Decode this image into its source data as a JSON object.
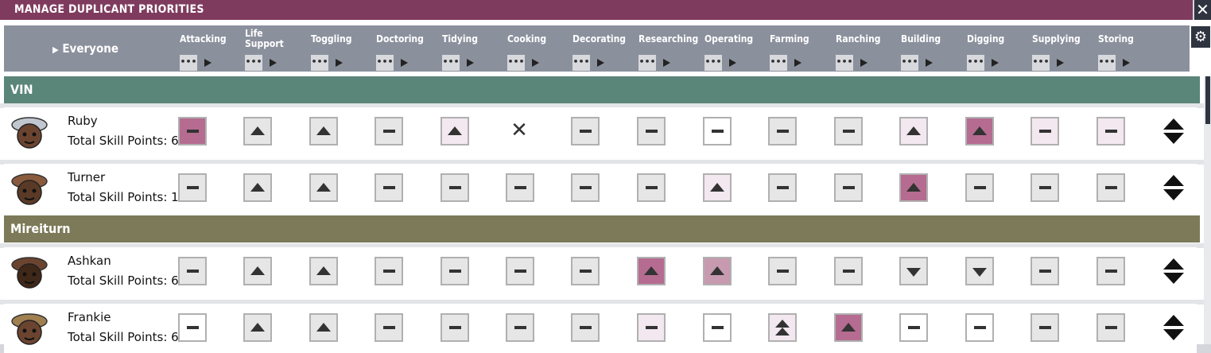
{
  "window": {
    "title": "MANAGE DUPLICANT PRIORITIES",
    "close_icon": "close-icon",
    "settings_icon": "gear-icon"
  },
  "everyone_label": "Everyone",
  "columns": [
    {
      "label": "Attacking"
    },
    {
      "label": "Life Support"
    },
    {
      "label": "Toggling"
    },
    {
      "label": "Doctoring"
    },
    {
      "label": "Tidying"
    },
    {
      "label": "Cooking"
    },
    {
      "label": "Decorating"
    },
    {
      "label": "Researching"
    },
    {
      "label": "Operating"
    },
    {
      "label": "Farming"
    },
    {
      "label": "Ranching"
    },
    {
      "label": "Building"
    },
    {
      "label": "Digging"
    },
    {
      "label": "Supplying"
    },
    {
      "label": "Storing"
    }
  ],
  "dots_label": "•••",
  "groups": [
    {
      "name": "VIN",
      "color": "#5a8579",
      "duplicants": [
        {
          "name": "Ruby",
          "skill_points": "Total Skill Points: 6",
          "cells": [
            "5d",
            "2u",
            "2u",
            "2d",
            "3u",
            "x",
            "2d",
            "2d",
            "1d",
            "2d",
            "2d",
            "3u",
            "5u",
            "3d",
            "3d"
          ]
        },
        {
          "name": "Turner",
          "skill_points": "Total Skill Points: 1",
          "cells": [
            "2d",
            "2u",
            "2u",
            "2d",
            "2d",
            "2d",
            "2d",
            "2d",
            "3u",
            "2d",
            "2d",
            "5u",
            "2d",
            "2d",
            "2d"
          ]
        }
      ]
    },
    {
      "name": "Mireiturn",
      "color": "#7c7a58",
      "duplicants": [
        {
          "name": "Ashkan",
          "skill_points": "Total Skill Points: 6",
          "cells": [
            "2d",
            "2u",
            "2u",
            "2d",
            "2d",
            "2d",
            "2d",
            "5u",
            "6u",
            "2d",
            "2d",
            "2v",
            "2v",
            "2d",
            "2d"
          ]
        },
        {
          "name": "Frankie",
          "skill_points": "Total Skill Points: 6",
          "cells": [
            "1d",
            "2u",
            "2u",
            "2d",
            "2d",
            "2d",
            "2d",
            "3d",
            "1d",
            "4w",
            "5u",
            "1d",
            "1d",
            "2d",
            "2d"
          ]
        }
      ]
    }
  ],
  "colors": {
    "title_bar": "#7f3b5e",
    "header": "#8b909d",
    "priority_high": "#b56c90",
    "priority_medium_high": "#f3e8ef"
  }
}
